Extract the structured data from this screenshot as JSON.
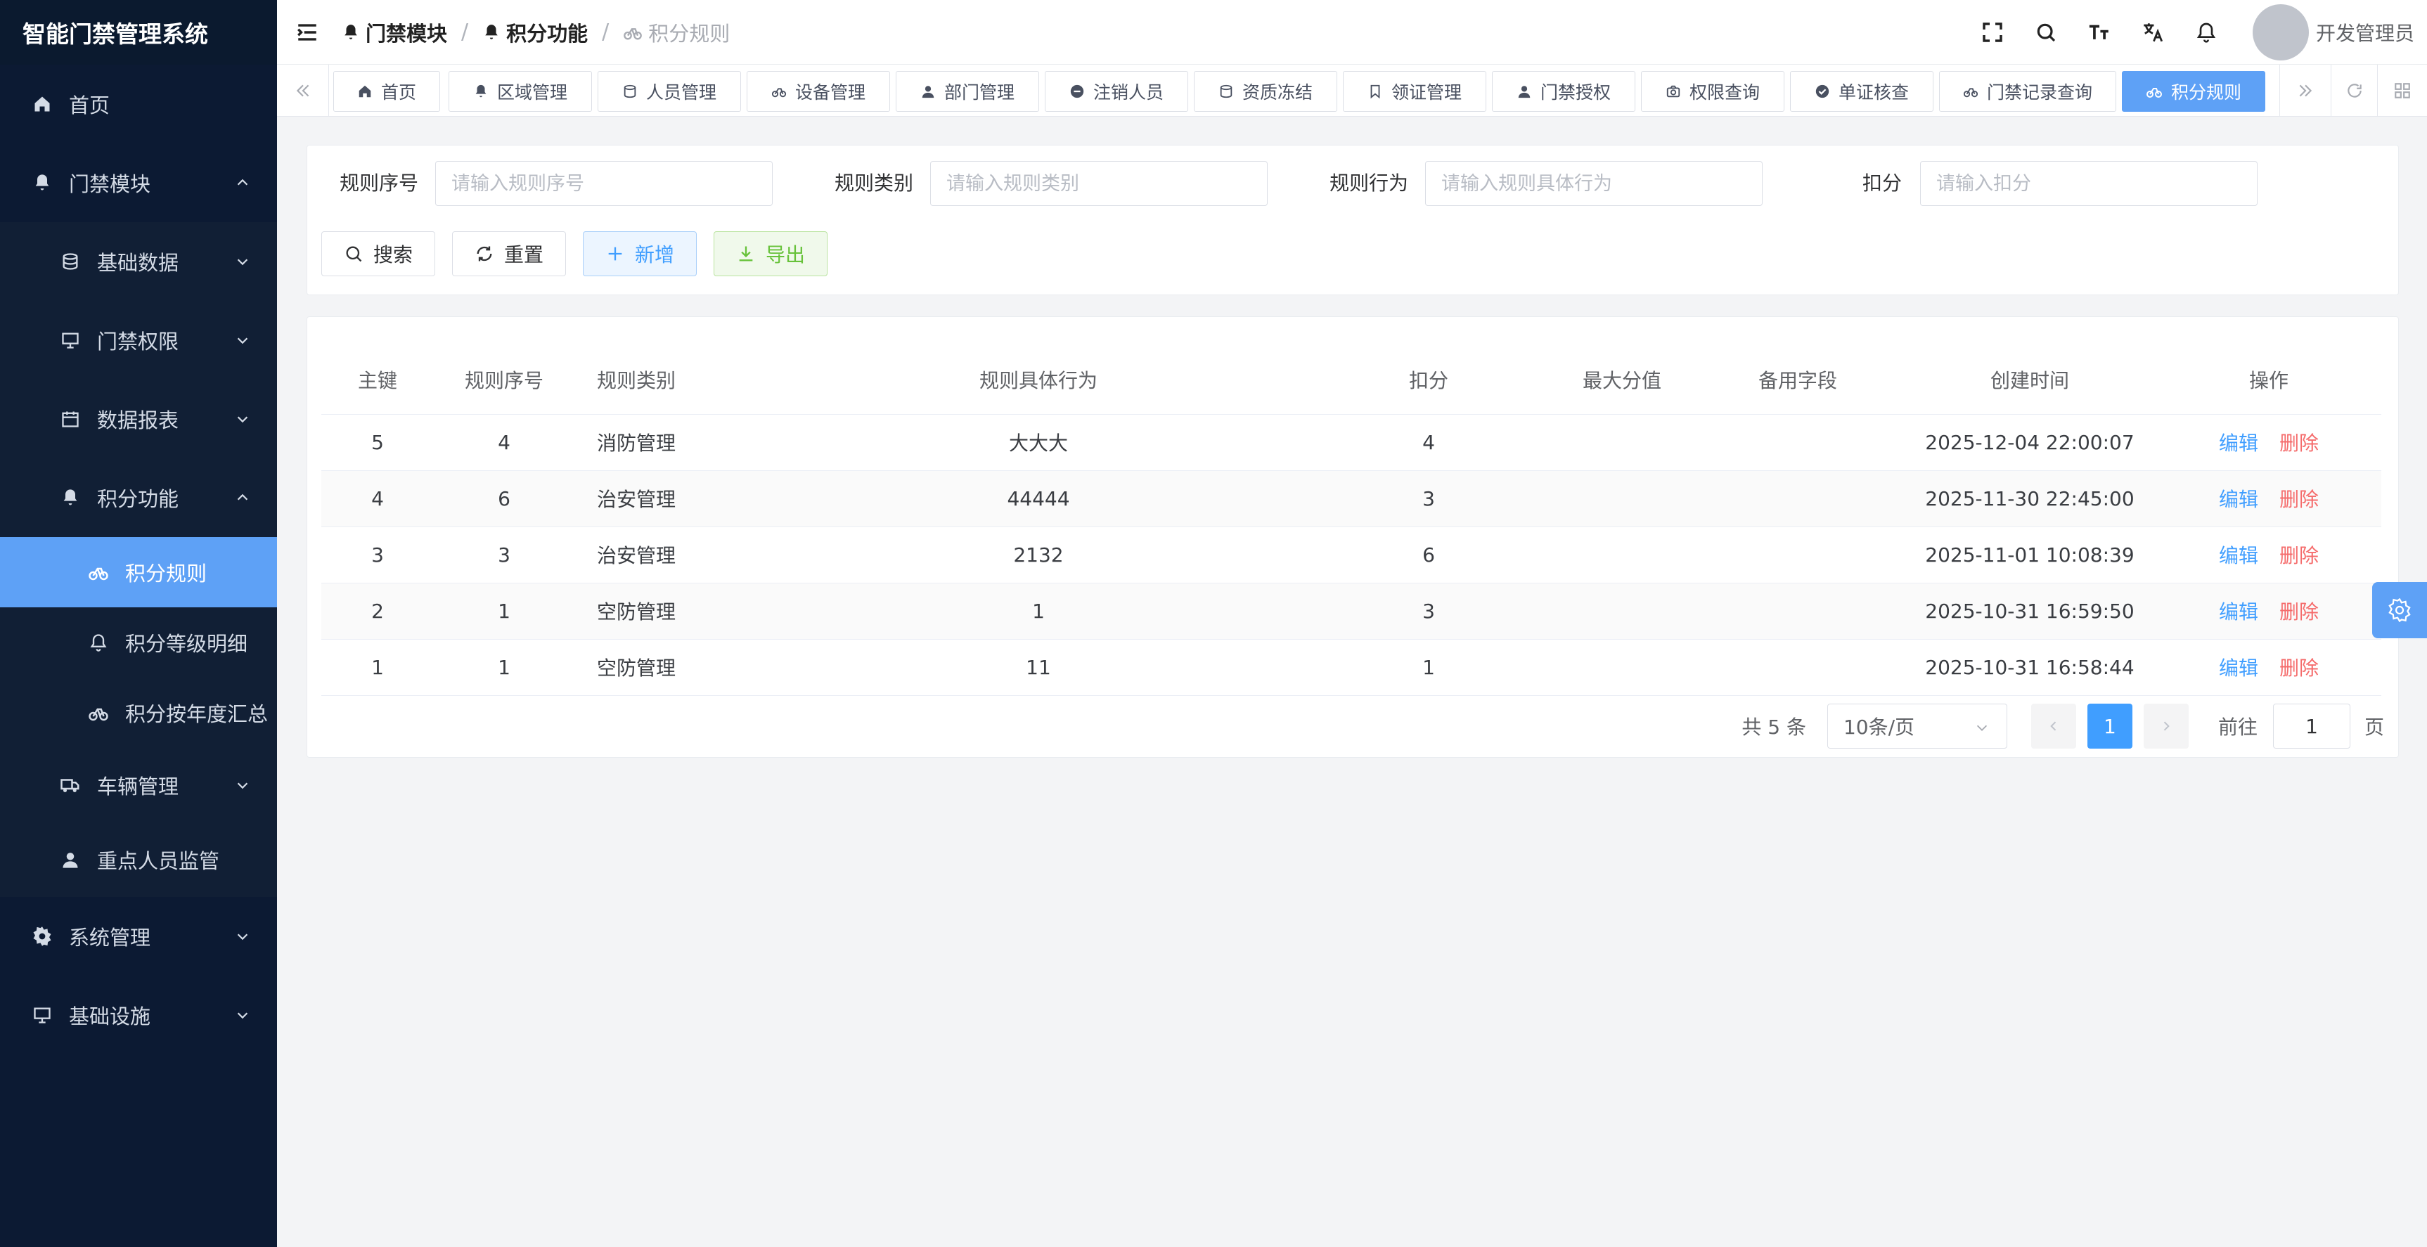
{
  "app": {
    "title": "智能门禁管理系统"
  },
  "sidebar": {
    "home": "首页",
    "access_module": "门禁模块",
    "basic_data": "基础数据",
    "access_permission": "门禁权限",
    "data_report": "数据报表",
    "points_function": "积分功能",
    "points_rules": "积分规则",
    "points_level_detail": "积分等级明细",
    "points_yearly_summary": "积分按年度汇总",
    "vehicle_management": "车辆管理",
    "key_person_monitor": "重点人员监管",
    "system_management": "系统管理",
    "infrastructure": "基础设施"
  },
  "breadcrumb": {
    "level1": "门禁模块",
    "level2": "积分功能",
    "level3": "积分规则",
    "sep": "/"
  },
  "header": {
    "user_name": "开发管理员"
  },
  "tabs": [
    {
      "label": "首页"
    },
    {
      "label": "区域管理"
    },
    {
      "label": "人员管理"
    },
    {
      "label": "设备管理"
    },
    {
      "label": "部门管理"
    },
    {
      "label": "注销人员"
    },
    {
      "label": "资质冻结"
    },
    {
      "label": "领证管理"
    },
    {
      "label": "门禁授权"
    },
    {
      "label": "权限查询"
    },
    {
      "label": "单证核查"
    },
    {
      "label": "门禁记录查询"
    },
    {
      "label": "积分规则"
    }
  ],
  "search": {
    "rule_no_label": "规则序号",
    "rule_no_placeholder": "请输入规则序号",
    "rule_type_label": "规则类别",
    "rule_type_placeholder": "请输入规则类别",
    "rule_action_label": "规则行为",
    "rule_action_placeholder": "请输入规则具体行为",
    "deduct_label": "扣分",
    "deduct_placeholder": "请输入扣分",
    "search_btn": "搜索",
    "reset_btn": "重置",
    "add_btn": "新增",
    "export_btn": "导出"
  },
  "table": {
    "headers": [
      "主键",
      "规则序号",
      "规则类别",
      "规则具体行为",
      "扣分",
      "最大分值",
      "备用字段",
      "创建时间",
      "操作"
    ],
    "rows": [
      {
        "id": "5",
        "no": "4",
        "type": "消防管理",
        "action": "大大大",
        "deduct": "4",
        "max": "",
        "spare": "",
        "created": "2025-12-04 22:00:07"
      },
      {
        "id": "4",
        "no": "6",
        "type": "治安管理",
        "action": "44444",
        "deduct": "3",
        "max": "",
        "spare": "",
        "created": "2025-11-30 22:45:00"
      },
      {
        "id": "3",
        "no": "3",
        "type": "治安管理",
        "action": "2132",
        "deduct": "6",
        "max": "",
        "spare": "",
        "created": "2025-11-01 10:08:39"
      },
      {
        "id": "2",
        "no": "1",
        "type": "空防管理",
        "action": "1",
        "deduct": "3",
        "max": "",
        "spare": "",
        "created": "2025-10-31 16:59:50"
      },
      {
        "id": "1",
        "no": "1",
        "type": "空防管理",
        "action": "11",
        "deduct": "1",
        "max": "",
        "spare": "",
        "created": "2025-10-31 16:58:44"
      }
    ],
    "edit_label": "编辑",
    "delete_label": "删除"
  },
  "pagination": {
    "total_text": "共 5 条",
    "page_size": "10条/页",
    "current_page": "1",
    "goto_label": "前往",
    "goto_value": "1",
    "page_suffix": "页"
  },
  "colors": {
    "sidebar_bg": "#0c1a33",
    "accent": "#5ea1f6",
    "link": "#409eff",
    "danger": "#f56c6c",
    "success": "#67c23a"
  }
}
